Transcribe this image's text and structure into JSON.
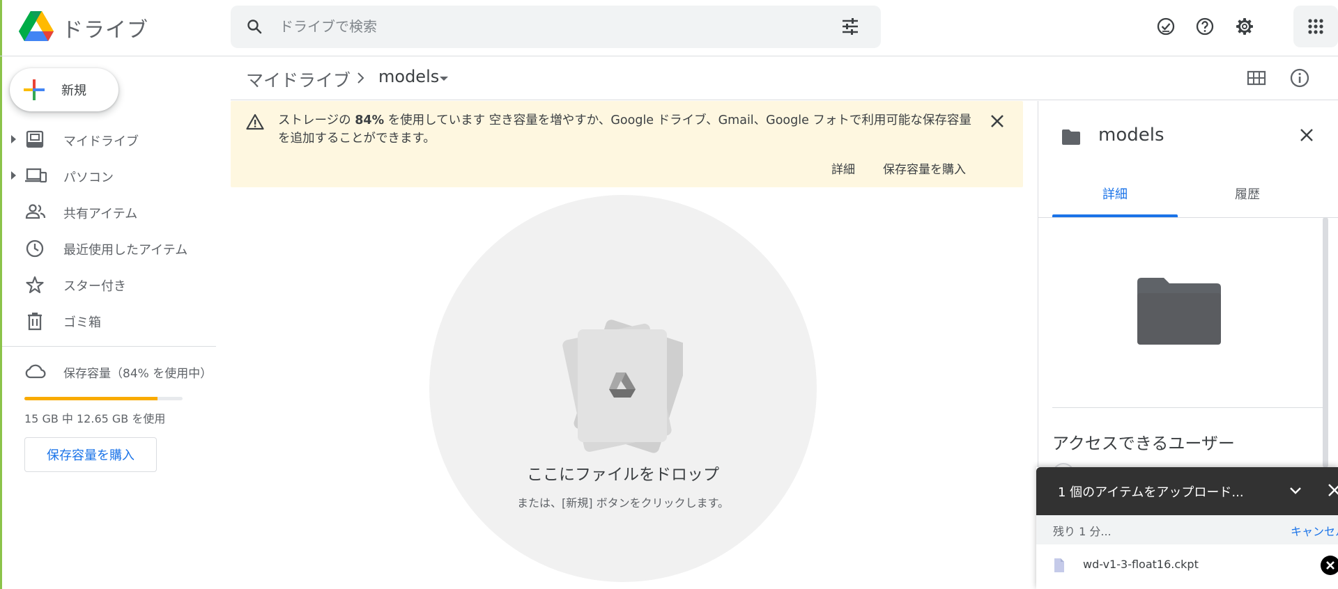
{
  "app": {
    "title": "ドライブ"
  },
  "search": {
    "placeholder": "ドライブで検索"
  },
  "sidebar": {
    "new_label": "新規",
    "items": [
      {
        "label": "マイドライブ",
        "icon": "my-drive-icon",
        "expandable": true
      },
      {
        "label": "パソコン",
        "icon": "computers-icon",
        "expandable": true
      },
      {
        "label": "共有アイテム",
        "icon": "shared-icon",
        "expandable": false
      },
      {
        "label": "最近使用したアイテム",
        "icon": "recent-icon",
        "expandable": false
      },
      {
        "label": "スター付き",
        "icon": "star-icon",
        "expandable": false
      },
      {
        "label": "ゴミ箱",
        "icon": "trash-icon",
        "expandable": false
      }
    ],
    "storage": {
      "label": "保存容量（84% を使用中）",
      "used_fraction": 0.84,
      "used_text": "15 GB 中 12.65 GB を使用",
      "buy_label": "保存容量を購入",
      "bar_color": "#f9ab00"
    }
  },
  "breadcrumb": {
    "root": "マイドライブ",
    "current": "models"
  },
  "banner": {
    "prefix": "ストレージの ",
    "percent": "84%",
    "message": " を使用しています 空き容量を増やすか、Google ドライブ、Gmail、Google フォトで利用可能な保存容量を追加することができます。",
    "details_label": "詳細",
    "buy_label": "保存容量を購入",
    "bg_color": "#fef7e0"
  },
  "dropzone": {
    "title": "ここにファイルをドロップ",
    "subtitle": "または、[新規] ボタンをクリックします。"
  },
  "details_panel": {
    "title": "models",
    "tabs": [
      "詳細",
      "履歴"
    ],
    "active_tab": "詳細",
    "access_heading": "アクセスできるユーザー"
  },
  "upload": {
    "title": "1 個のアイテムをアップロード...",
    "remaining": "残り 1 分...",
    "cancel_label": "キャンセル",
    "file_name": "wd-v1-3-float16.ckpt"
  },
  "colors": {
    "accent": "#1a73e8",
    "toast_bg": "#323232"
  }
}
